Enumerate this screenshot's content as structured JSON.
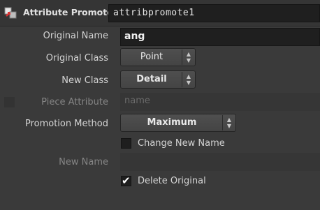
{
  "node": {
    "type": "Attribute Promote",
    "name": "attribpromote1",
    "icon": "attribute-promote-icon"
  },
  "params": {
    "original_name": {
      "label": "Original Name",
      "value": "ang"
    },
    "original_class": {
      "label": "Original Class",
      "value": "Point"
    },
    "new_class": {
      "label": "New Class",
      "value": "Detail"
    },
    "piece_attribute": {
      "label": "Piece Attribute",
      "placeholder": "name",
      "enabled": false
    },
    "promotion_method": {
      "label": "Promotion Method",
      "value": "Maximum"
    },
    "change_new_name": {
      "label": "Change New Name",
      "checked": false
    },
    "new_name": {
      "label": "New Name",
      "value": "",
      "enabled": false
    },
    "delete_original": {
      "label": "Delete Original",
      "checked": true
    }
  },
  "glyphs": {
    "menu_arrows": "▲\n▼",
    "check": "✔"
  },
  "colors": {
    "background": "#3a3a3a",
    "field": "#1f1f1f",
    "menu": "#4a4a4a"
  }
}
